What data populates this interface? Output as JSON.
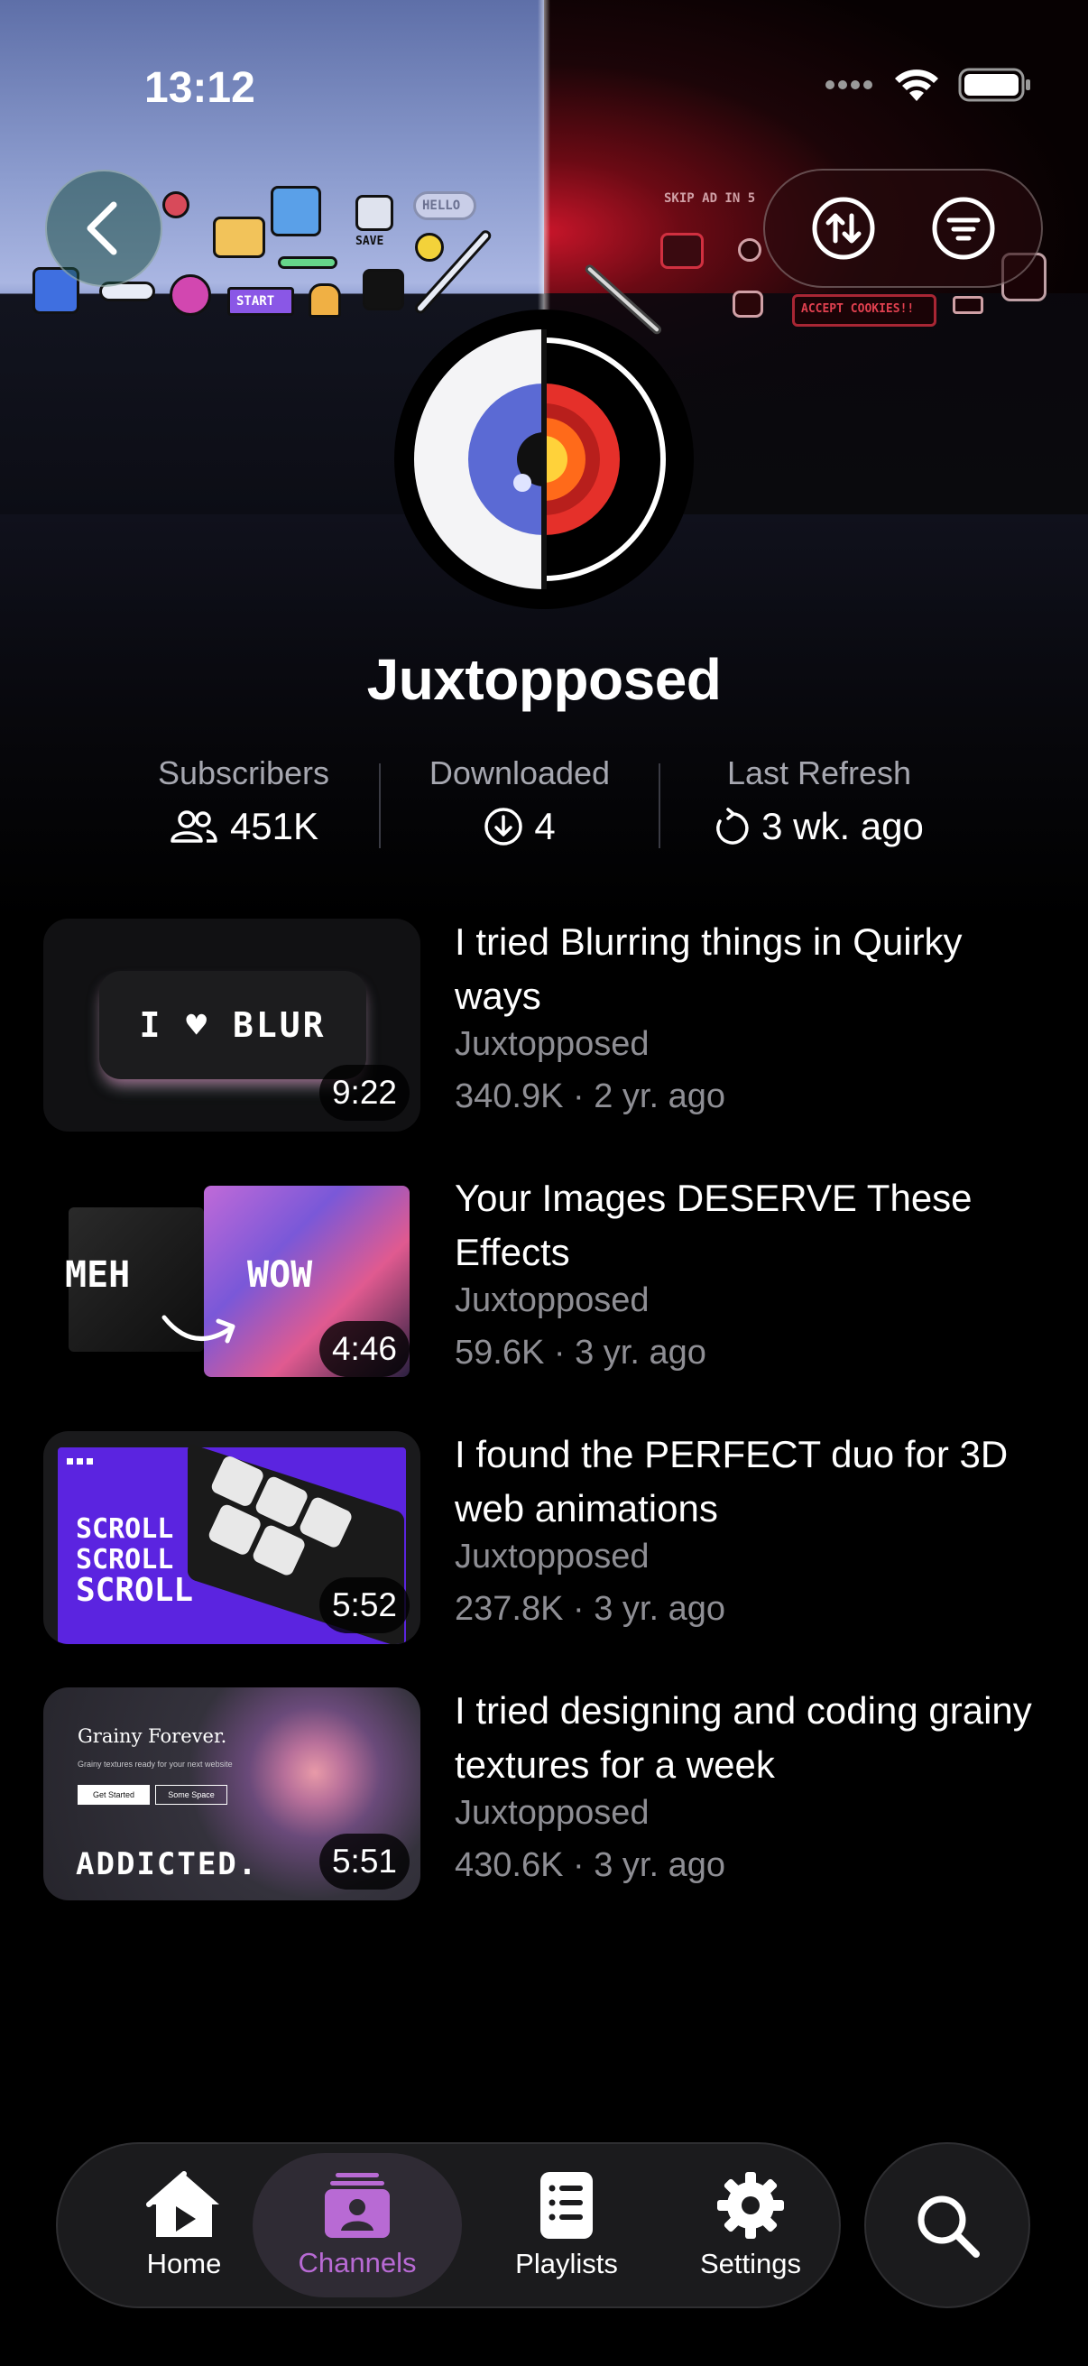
{
  "status_bar": {
    "time": "13:12"
  },
  "banner": {
    "left_labels": {
      "hello": "HELLO",
      "save": "SAVE",
      "start": "START"
    },
    "right_labels": {
      "skip_ad": "SKIP AD IN 5",
      "accept_cookies": "ACCEPT COOKIES!!"
    }
  },
  "channel": {
    "name": "Juxtopposed",
    "stats": [
      {
        "label": "Subscribers",
        "value": "451K",
        "icon": "people-icon"
      },
      {
        "label": "Downloaded",
        "value": "4",
        "icon": "download-circle-icon"
      },
      {
        "label": "Last Refresh",
        "value": "3 wk. ago",
        "icon": "refresh-icon"
      }
    ]
  },
  "videos": [
    {
      "title": "I tried Blurring things in Quirky ways",
      "channel": "Juxtopposed",
      "meta": "340.9K · 2 yr. ago",
      "duration": "9:22",
      "thumb_text": "I ♥ BLUR"
    },
    {
      "title": "Your Images DESERVE These Effects",
      "channel": "Juxtopposed",
      "meta": "59.6K · 3 yr. ago",
      "duration": "4:46",
      "thumb_left": "MEH",
      "thumb_right": "WOW"
    },
    {
      "title": "I found the PERFECT duo for 3D web animations",
      "channel": "Juxtopposed",
      "meta": "237.8K · 3 yr. ago",
      "duration": "5:52",
      "thumb_lines": [
        "SCROLL",
        "SCROLL",
        "SCROLL"
      ]
    },
    {
      "title": "I tried designing and coding grainy textures for a week",
      "channel": "Juxtopposed",
      "meta": "430.6K · 3 yr. ago",
      "duration": "5:51",
      "thumb_heading": "Grainy Forever.",
      "thumb_sub": "Grainy textures ready for your next website",
      "thumb_btn1": "Get Started",
      "thumb_btn2": "Some Space",
      "thumb_bottom": "ADDICTED."
    }
  ],
  "tabbar": {
    "tabs": [
      {
        "label": "Home",
        "icon": "home-play-icon",
        "active": false
      },
      {
        "label": "Channels",
        "icon": "channels-icon",
        "active": true
      },
      {
        "label": "Playlists",
        "icon": "playlists-icon",
        "active": false
      },
      {
        "label": "Settings",
        "icon": "gear-icon",
        "active": false
      }
    ],
    "search_icon": "search-icon"
  },
  "colors": {
    "accent": "#b86ad4",
    "secondary_text": "#8e8e94",
    "tab_bg": "#1b1b1d"
  }
}
